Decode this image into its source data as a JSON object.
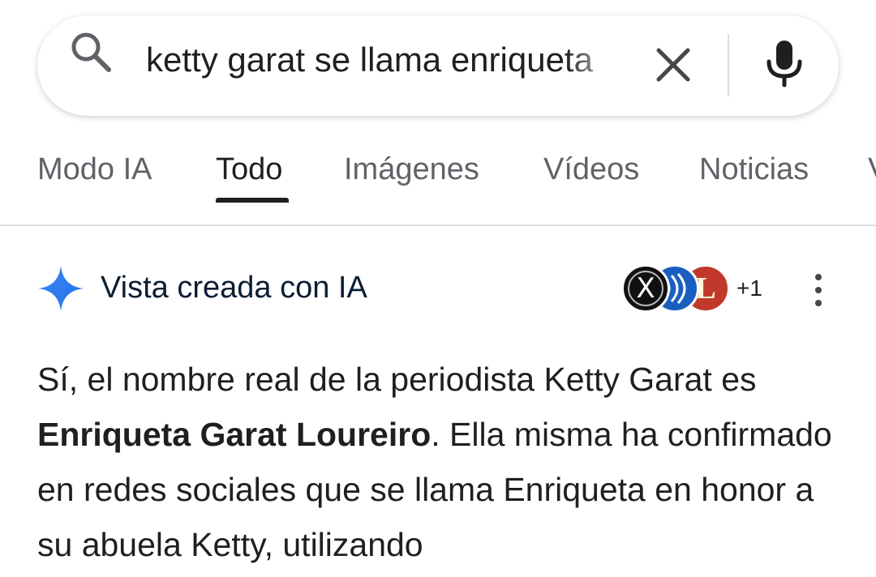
{
  "search": {
    "query": "ketty garat se llama enriqueta"
  },
  "tabs": [
    {
      "label": "Modo IA"
    },
    {
      "label": "Todo"
    },
    {
      "label": "Imágenes"
    },
    {
      "label": "Vídeos"
    },
    {
      "label": "Noticias"
    }
  ],
  "active_tab": "Todo",
  "ai_overview": {
    "title": "Vista creada con IA",
    "sources_more": "+1",
    "source_icons": [
      "x-logo-icon",
      "sound-waves-icon",
      "letter-l-icon"
    ],
    "answer": {
      "part1": "Sí, el nombre real de la periodista Ketty Garat es ",
      "bold": "Enriqueta Garat Loureiro",
      "part2": ". Ella misma ha confirmado en redes sociales que se llama Enriqueta en honor a su abuela Ketty, utilizando"
    }
  },
  "colors": {
    "accent_blue": "#1a73e8",
    "text_primary": "#1f1f1f",
    "text_secondary": "#5f6368",
    "ai_title": "#0b1d33"
  }
}
